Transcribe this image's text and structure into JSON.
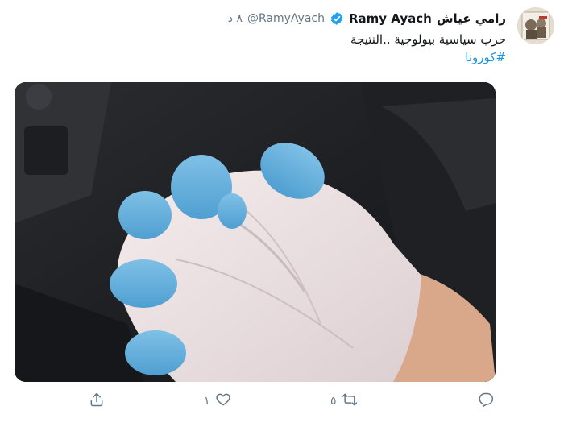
{
  "tweet": {
    "author": {
      "name_ar": "رامي عياش",
      "name_en": "Ramy Ayach",
      "handle": "@RamyAyach",
      "verified": true
    },
    "time": "٨ د",
    "text": "حرب سياسية بيولوجية ..النتيجة",
    "hashtag": "#كورونا",
    "image_alt": "Two hands in white and blue latex gloves clasped together inside a car"
  },
  "actions": {
    "reply_icon": "reply-icon",
    "retweet_icon": "retweet-icon",
    "retweet_count": "٥",
    "like_icon": "heart-icon",
    "like_count": "١",
    "share_icon": "share-icon"
  },
  "colors": {
    "text": "#14171a",
    "muted": "#657786",
    "link": "#1b95e0",
    "verified": "#1da1f2"
  }
}
